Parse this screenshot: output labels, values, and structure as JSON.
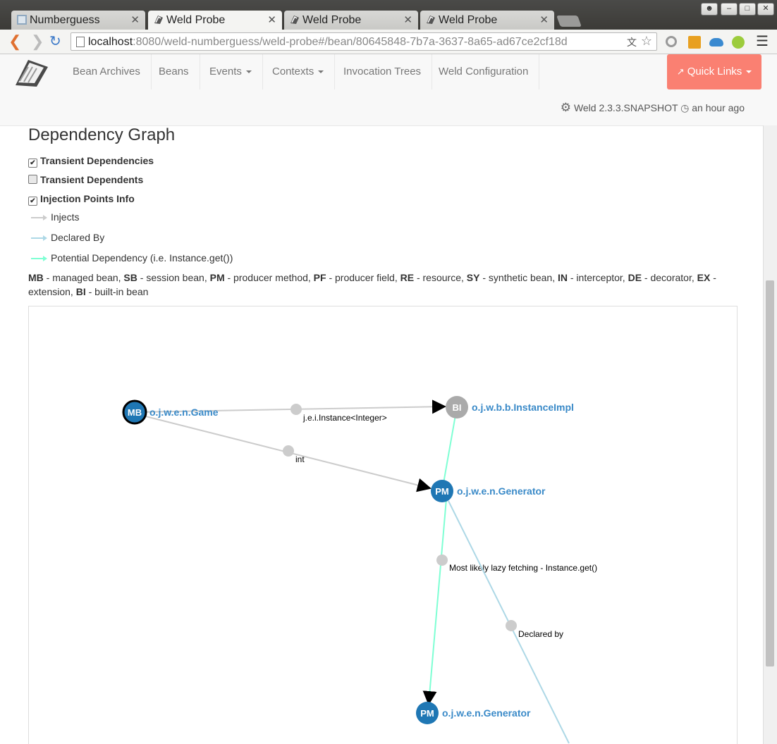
{
  "browser": {
    "tabs": [
      {
        "title": "Numberguess"
      },
      {
        "title": "Weld Probe"
      },
      {
        "title": "Weld Probe"
      },
      {
        "title": "Weld Probe"
      }
    ],
    "url_host": "localhost",
    "url_rest": ":8080/weld-numberguess/weld-probe#/bean/80645848-7b7a-3637-8a65-ad67ce2cf18d"
  },
  "appnav": {
    "items": [
      "Bean Archives",
      "Beans",
      "Events",
      "Contexts",
      "Invocation Trees",
      "Weld Configuration"
    ],
    "quick_links": "Quick Links",
    "version": "Weld 2.3.3.SNAPSHOT",
    "time": "an hour ago"
  },
  "page": {
    "title": "Dependency Graph",
    "checkboxes": [
      {
        "label": "Transient Dependencies",
        "checked": true
      },
      {
        "label": "Transient Dependents",
        "checked": false
      },
      {
        "label": "Injection Points Info",
        "checked": true
      }
    ],
    "legend": [
      {
        "label": "Injects",
        "color": "#cccccc"
      },
      {
        "label": "Declared By",
        "color": "#add8e6"
      },
      {
        "label": "Potential Dependency (i.e. Instance.get())",
        "color": "#7fffd4"
      }
    ],
    "abbreviations": [
      {
        "code": "MB",
        "desc": " - managed bean, "
      },
      {
        "code": "SB",
        "desc": " - session bean, "
      },
      {
        "code": "PM",
        "desc": " - producer method, "
      },
      {
        "code": "PF",
        "desc": " - producer field, "
      },
      {
        "code": "RE",
        "desc": " - resource, "
      },
      {
        "code": "SY",
        "desc": " - synthetic bean, "
      },
      {
        "code": "IN",
        "desc": " - interceptor, "
      },
      {
        "code": "DE",
        "desc": " - decorator, "
      },
      {
        "code": "EX",
        "desc": " - extension, "
      },
      {
        "code": "BI",
        "desc": " - built-in bean"
      }
    ]
  },
  "graph": {
    "nodes": [
      {
        "id": "game",
        "kind": "MB",
        "label": "o.j.w.e.n.Game",
        "color": "#1f77b4",
        "selected": true
      },
      {
        "id": "instance",
        "kind": "BI",
        "label": "o.j.w.b.b.InstanceImpl",
        "color": "#aaaaaa",
        "selected": false
      },
      {
        "id": "gen1",
        "kind": "PM",
        "label": "o.j.w.e.n.Generator",
        "color": "#1f77b4",
        "selected": false
      },
      {
        "id": "gen2",
        "kind": "PM",
        "label": "o.j.w.e.n.Generator",
        "color": "#1f77b4",
        "selected": false
      }
    ],
    "edges": [
      {
        "from": "game",
        "to": "instance",
        "type": "injects",
        "label": "j.e.i.Instance<Integer>"
      },
      {
        "from": "game",
        "to": "gen1",
        "type": "injects",
        "label": "int"
      },
      {
        "from": "gen1",
        "to": "instance",
        "type": "potential",
        "label": ""
      },
      {
        "from": "gen1",
        "to": "gen2",
        "type": "potential",
        "label": "Most likely lazy fetching - Instance.get()"
      },
      {
        "from": "gen1",
        "to": "offscreen",
        "type": "declared",
        "label": "Declared by"
      }
    ]
  }
}
